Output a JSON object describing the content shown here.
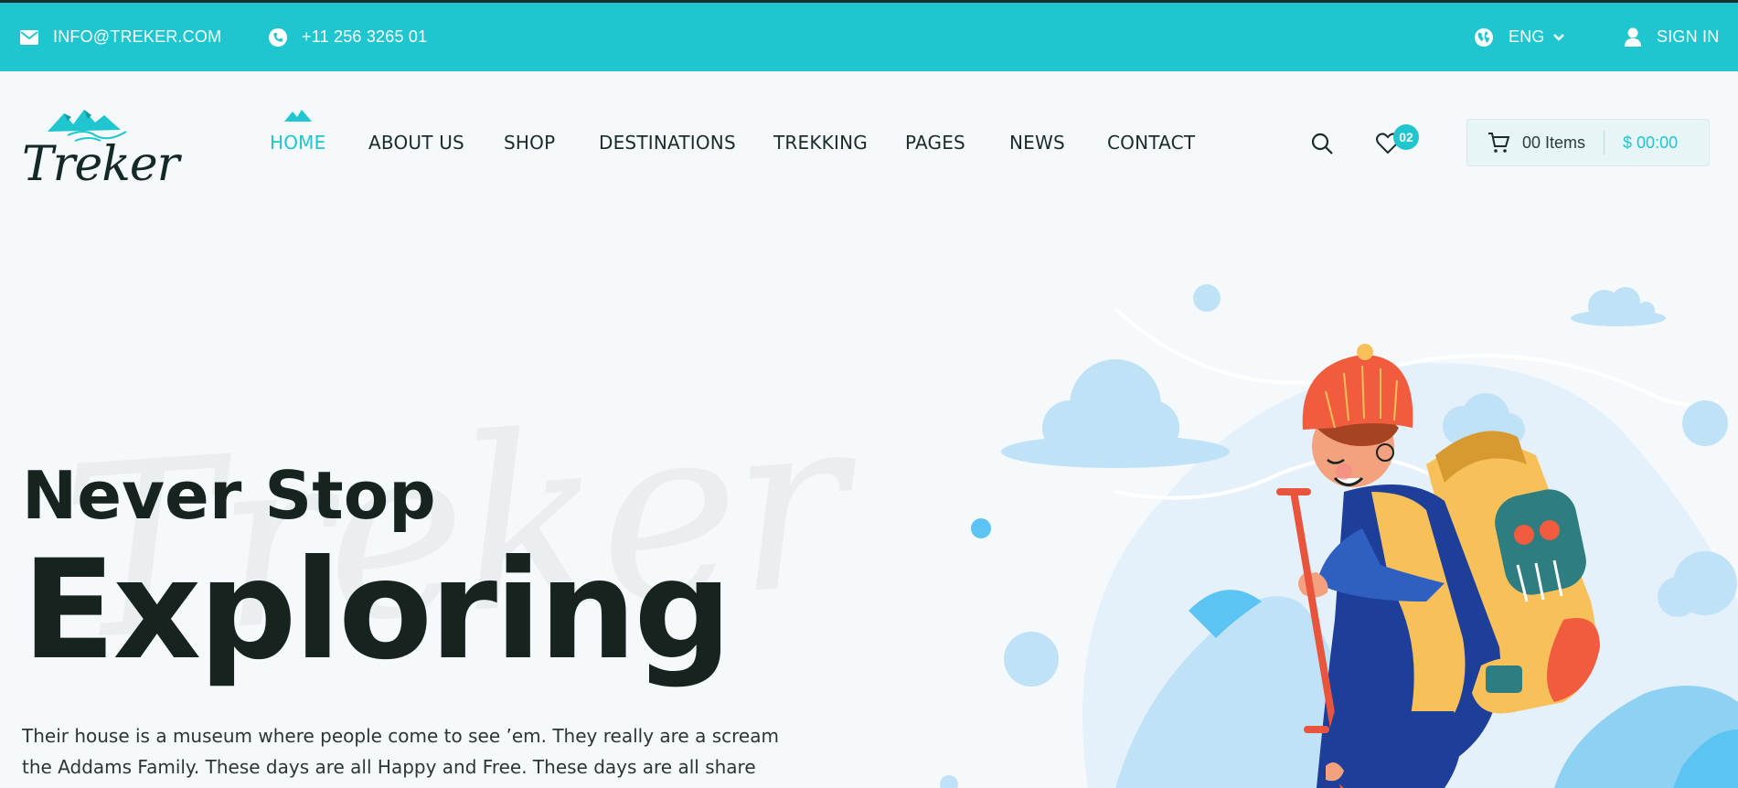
{
  "topbar": {
    "email": "INFO@TREKER.COM",
    "phone": "+11 256 3265 01",
    "language": "ENG",
    "sign_in": "SIGN IN"
  },
  "logo": {
    "text": "Treker"
  },
  "nav": {
    "items": [
      {
        "label": "HOME",
        "active": true
      },
      {
        "label": "ABOUT US"
      },
      {
        "label": "SHOP"
      },
      {
        "label": "DESTINATIONS"
      },
      {
        "label": "TREKKING"
      },
      {
        "label": "PAGES"
      },
      {
        "label": "NEWS"
      },
      {
        "label": "CONTACT"
      }
    ]
  },
  "wishlist": {
    "count": "02"
  },
  "cart": {
    "items": "00 Items",
    "total": "$ 00:00"
  },
  "hero": {
    "watermark": "Treker",
    "title_line1": "Never Stop",
    "title_line2": "Exploring",
    "description": "Their house is a museum where people come to see ’em. They really are a scream the Addams Family. These days are all Happy and Free. These days are all share"
  },
  "colors": {
    "accent": "#1fc5cf",
    "heading": "#16231f",
    "background": "#f5f9fc"
  },
  "icons": [
    "mail-icon",
    "phone-icon",
    "globe-icon",
    "chevron-down-icon",
    "user-icon",
    "search-icon",
    "heart-icon",
    "cart-icon"
  ]
}
